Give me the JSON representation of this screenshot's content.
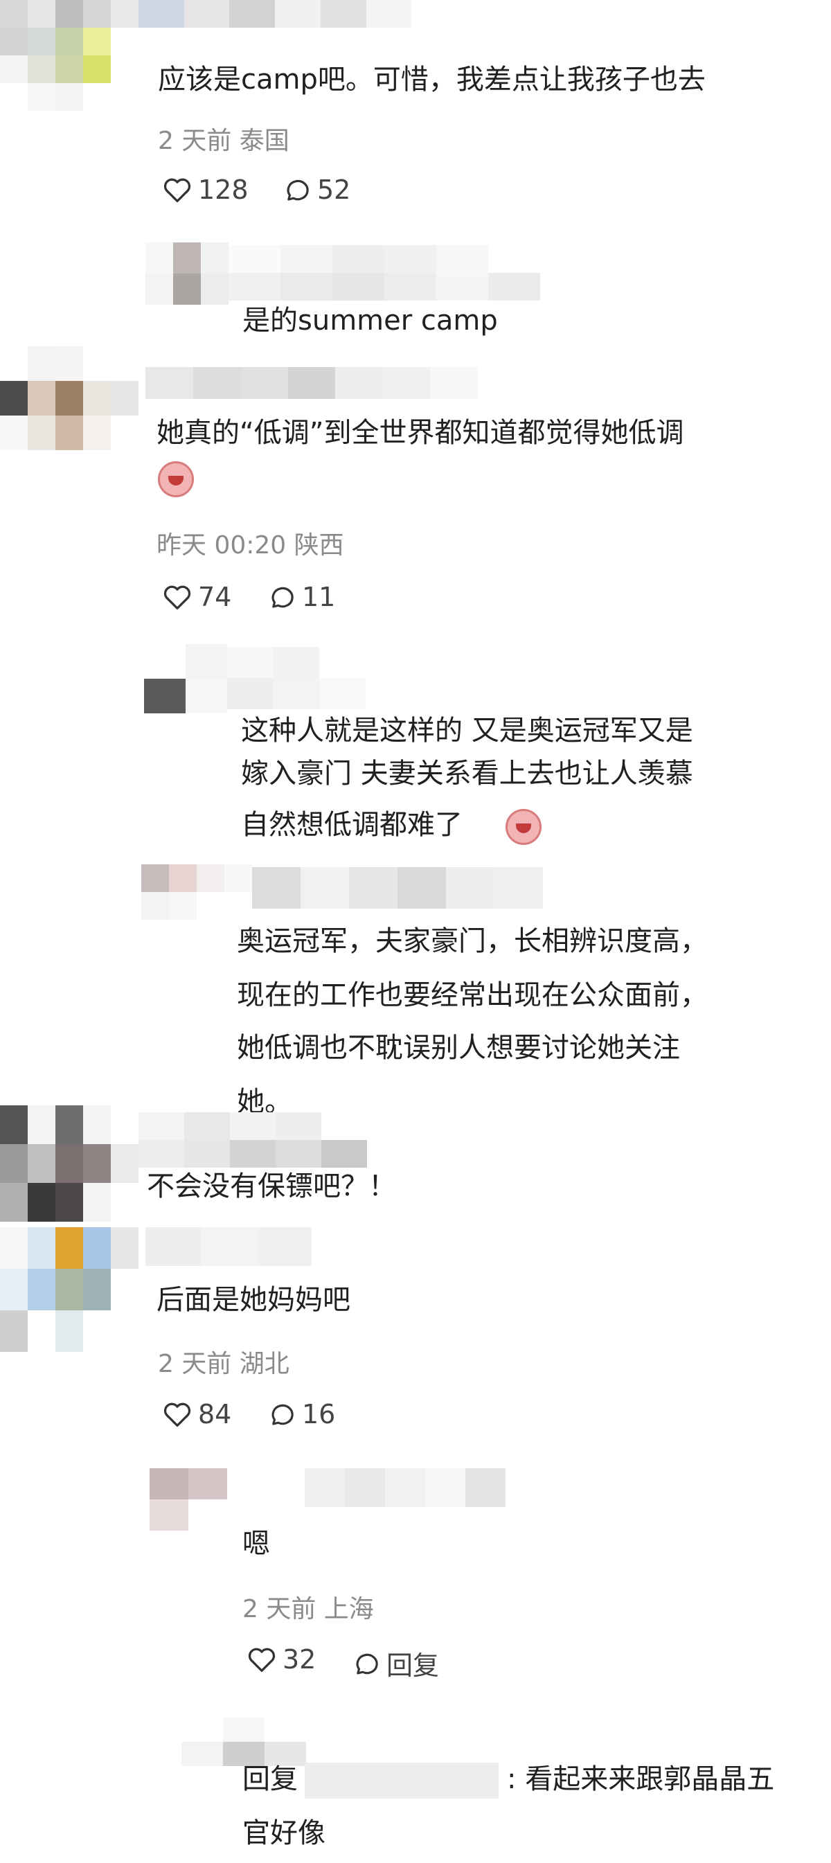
{
  "comments": [
    {
      "text": "应该是camp吧。可惜，我差点让我孩子也去",
      "meta": "2 天前 泰国",
      "likes": "128",
      "replies": "52",
      "sub": [
        {
          "text": "是的summer camp"
        }
      ]
    },
    {
      "text": "她真的“低调”到全世界都知道都觉得她低调",
      "meta": "昨天 00:20 陕西",
      "likes": "74",
      "replies": "11",
      "sub": [
        {
          "lines": [
            "这种人就是这样的 又是奥运冠军又是",
            "嫁入豪门 夫妻关系看上去也让人羡慕",
            "自然想低调都难了"
          ]
        },
        {
          "lines": [
            "奥运冠军，夫家豪门，长相辨识度高，",
            "现在的工作也要经常出现在公众面前，",
            "她低调也不耽误别人想要讨论她关注",
            "她。"
          ]
        }
      ]
    },
    {
      "text": "不会没有保镖吧？！"
    },
    {
      "text": "后面是她妈妈吧",
      "meta": "2 天前 湖北",
      "likes": "84",
      "replies": "16",
      "sub": [
        {
          "text": "嗯",
          "meta": "2 天前 上海",
          "likes": "32",
          "reply_label": "回复"
        },
        {
          "prefix": "回复",
          "lines_after": [
            ": 看起来来跟郭晶晶五",
            "官好像"
          ]
        }
      ]
    }
  ],
  "icons": {
    "like": "heart-outline-icon",
    "comment": "speech-bubble-icon"
  }
}
